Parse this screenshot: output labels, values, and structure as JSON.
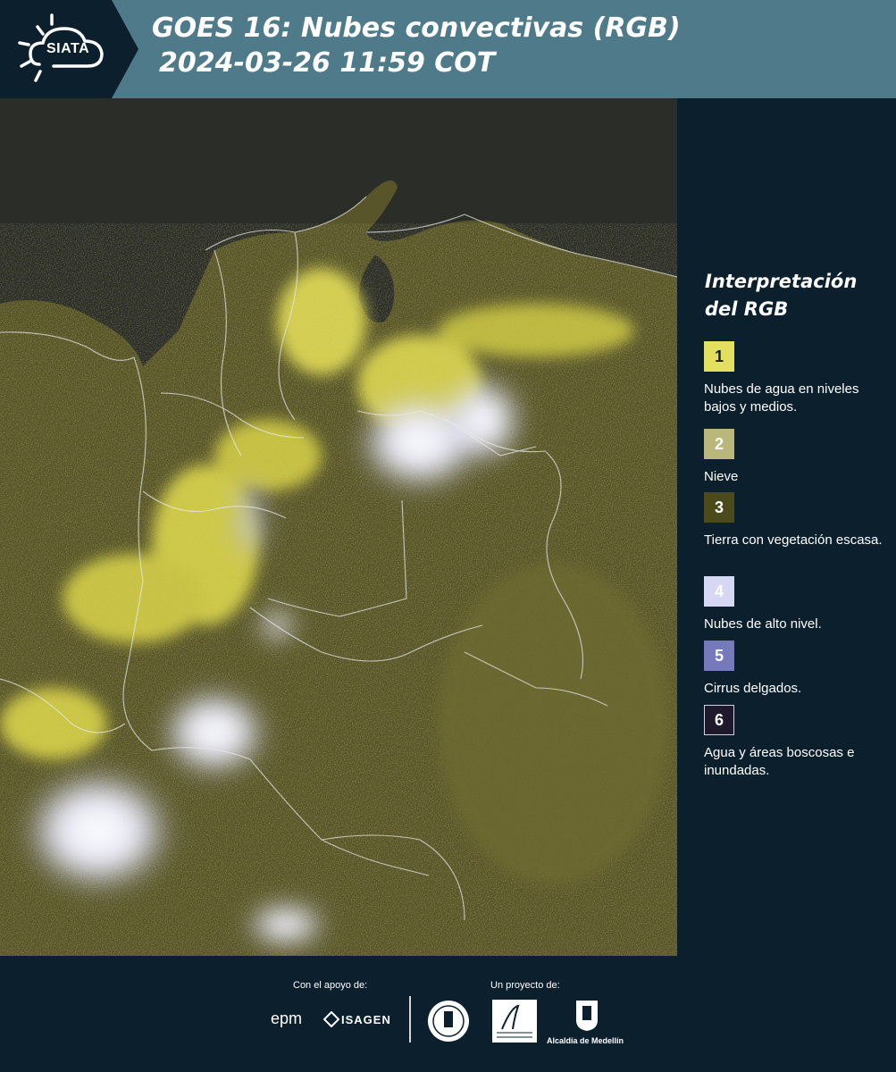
{
  "header": {
    "logo_text": "SIATA",
    "title_line1": "GOES 16: Nubes convectivas (RGB)",
    "title_line2": "2024-03-26 11:59 COT"
  },
  "legend": {
    "title_line1": "Interpretación",
    "title_line2": "del RGB",
    "items": [
      {
        "number": "1",
        "color": "#e3e060",
        "text_color": "#1a1a1a",
        "label": "Nubes de agua en niveles bajos y medios."
      },
      {
        "number": "2",
        "color": "#b9b87a",
        "text_color": "#ffffff",
        "label": "Nieve"
      },
      {
        "number": "3",
        "color": "#4a4a1c",
        "text_color": "#ffffff",
        "label": "Tierra con vegetación escasa."
      },
      {
        "number": "4",
        "color": "#d6d8f3",
        "text_color": "#ffffff",
        "label": "Nubes de alto nivel."
      },
      {
        "number": "5",
        "color": "#7679bb",
        "text_color": "#ffffff",
        "label": "Cirrus delgados."
      },
      {
        "number": "6",
        "color": "#1e1a2c",
        "text_color": "#ffffff",
        "label": "Agua y áreas boscosas e inundadas."
      }
    ]
  },
  "footer": {
    "support_label": "Con el apoyo de:",
    "project_label": "Un proyecto de:",
    "epm": "epm",
    "isagen": "ISAGEN",
    "alcaldia": "Alcaldía de Medellín"
  },
  "colors": {
    "header_bg": "#4f7a8a",
    "panel_bg": "#0b1f2c",
    "cloud_yellow": "#e8e45a",
    "cloud_white": "#f2f2fb",
    "land_olive": "#5e5a2c"
  }
}
